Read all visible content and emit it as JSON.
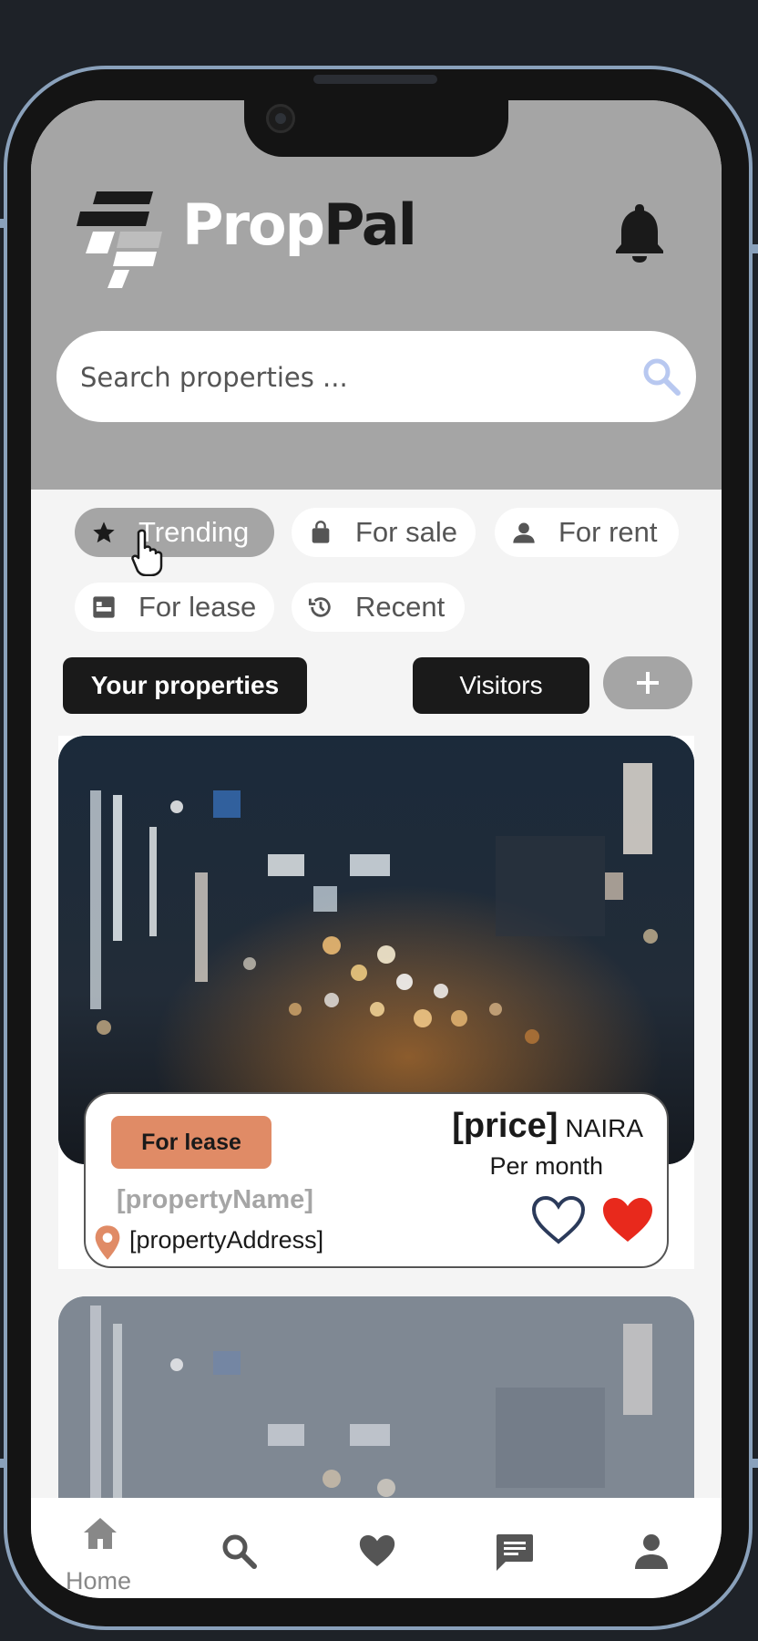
{
  "app": {
    "brand_part1": "Prop",
    "brand_part2": "Pal"
  },
  "search": {
    "placeholder": "Search properties ..."
  },
  "filters": [
    {
      "label": "Trending",
      "icon": "star-icon",
      "active": true
    },
    {
      "label": "For sale",
      "icon": "shopping-bag-icon",
      "active": false
    },
    {
      "label": "For rent",
      "icon": "person-icon",
      "active": false
    },
    {
      "label": "For lease",
      "icon": "bed-icon",
      "active": false
    },
    {
      "label": "Recent",
      "icon": "history-icon",
      "active": false
    }
  ],
  "tabs": {
    "your_properties": "Your properties",
    "visitors": "Visitors",
    "add": "+"
  },
  "listing": {
    "badge": "For lease",
    "price": "[price]",
    "currency": "NAIRA",
    "period": "Per month",
    "name": "[propertyName]",
    "address": "[propertyAddress]"
  },
  "nav": {
    "home_label": "Home",
    "items": [
      "home-icon",
      "search-icon",
      "heart-icon",
      "chat-icon",
      "profile-icon"
    ]
  },
  "colors": {
    "header_bg": "#a5a5a5",
    "badge_bg": "#e08b66",
    "heart_red": "#e8291c",
    "search_icon": "#b8c8f0",
    "dark_pill": "#1a1a1a"
  }
}
